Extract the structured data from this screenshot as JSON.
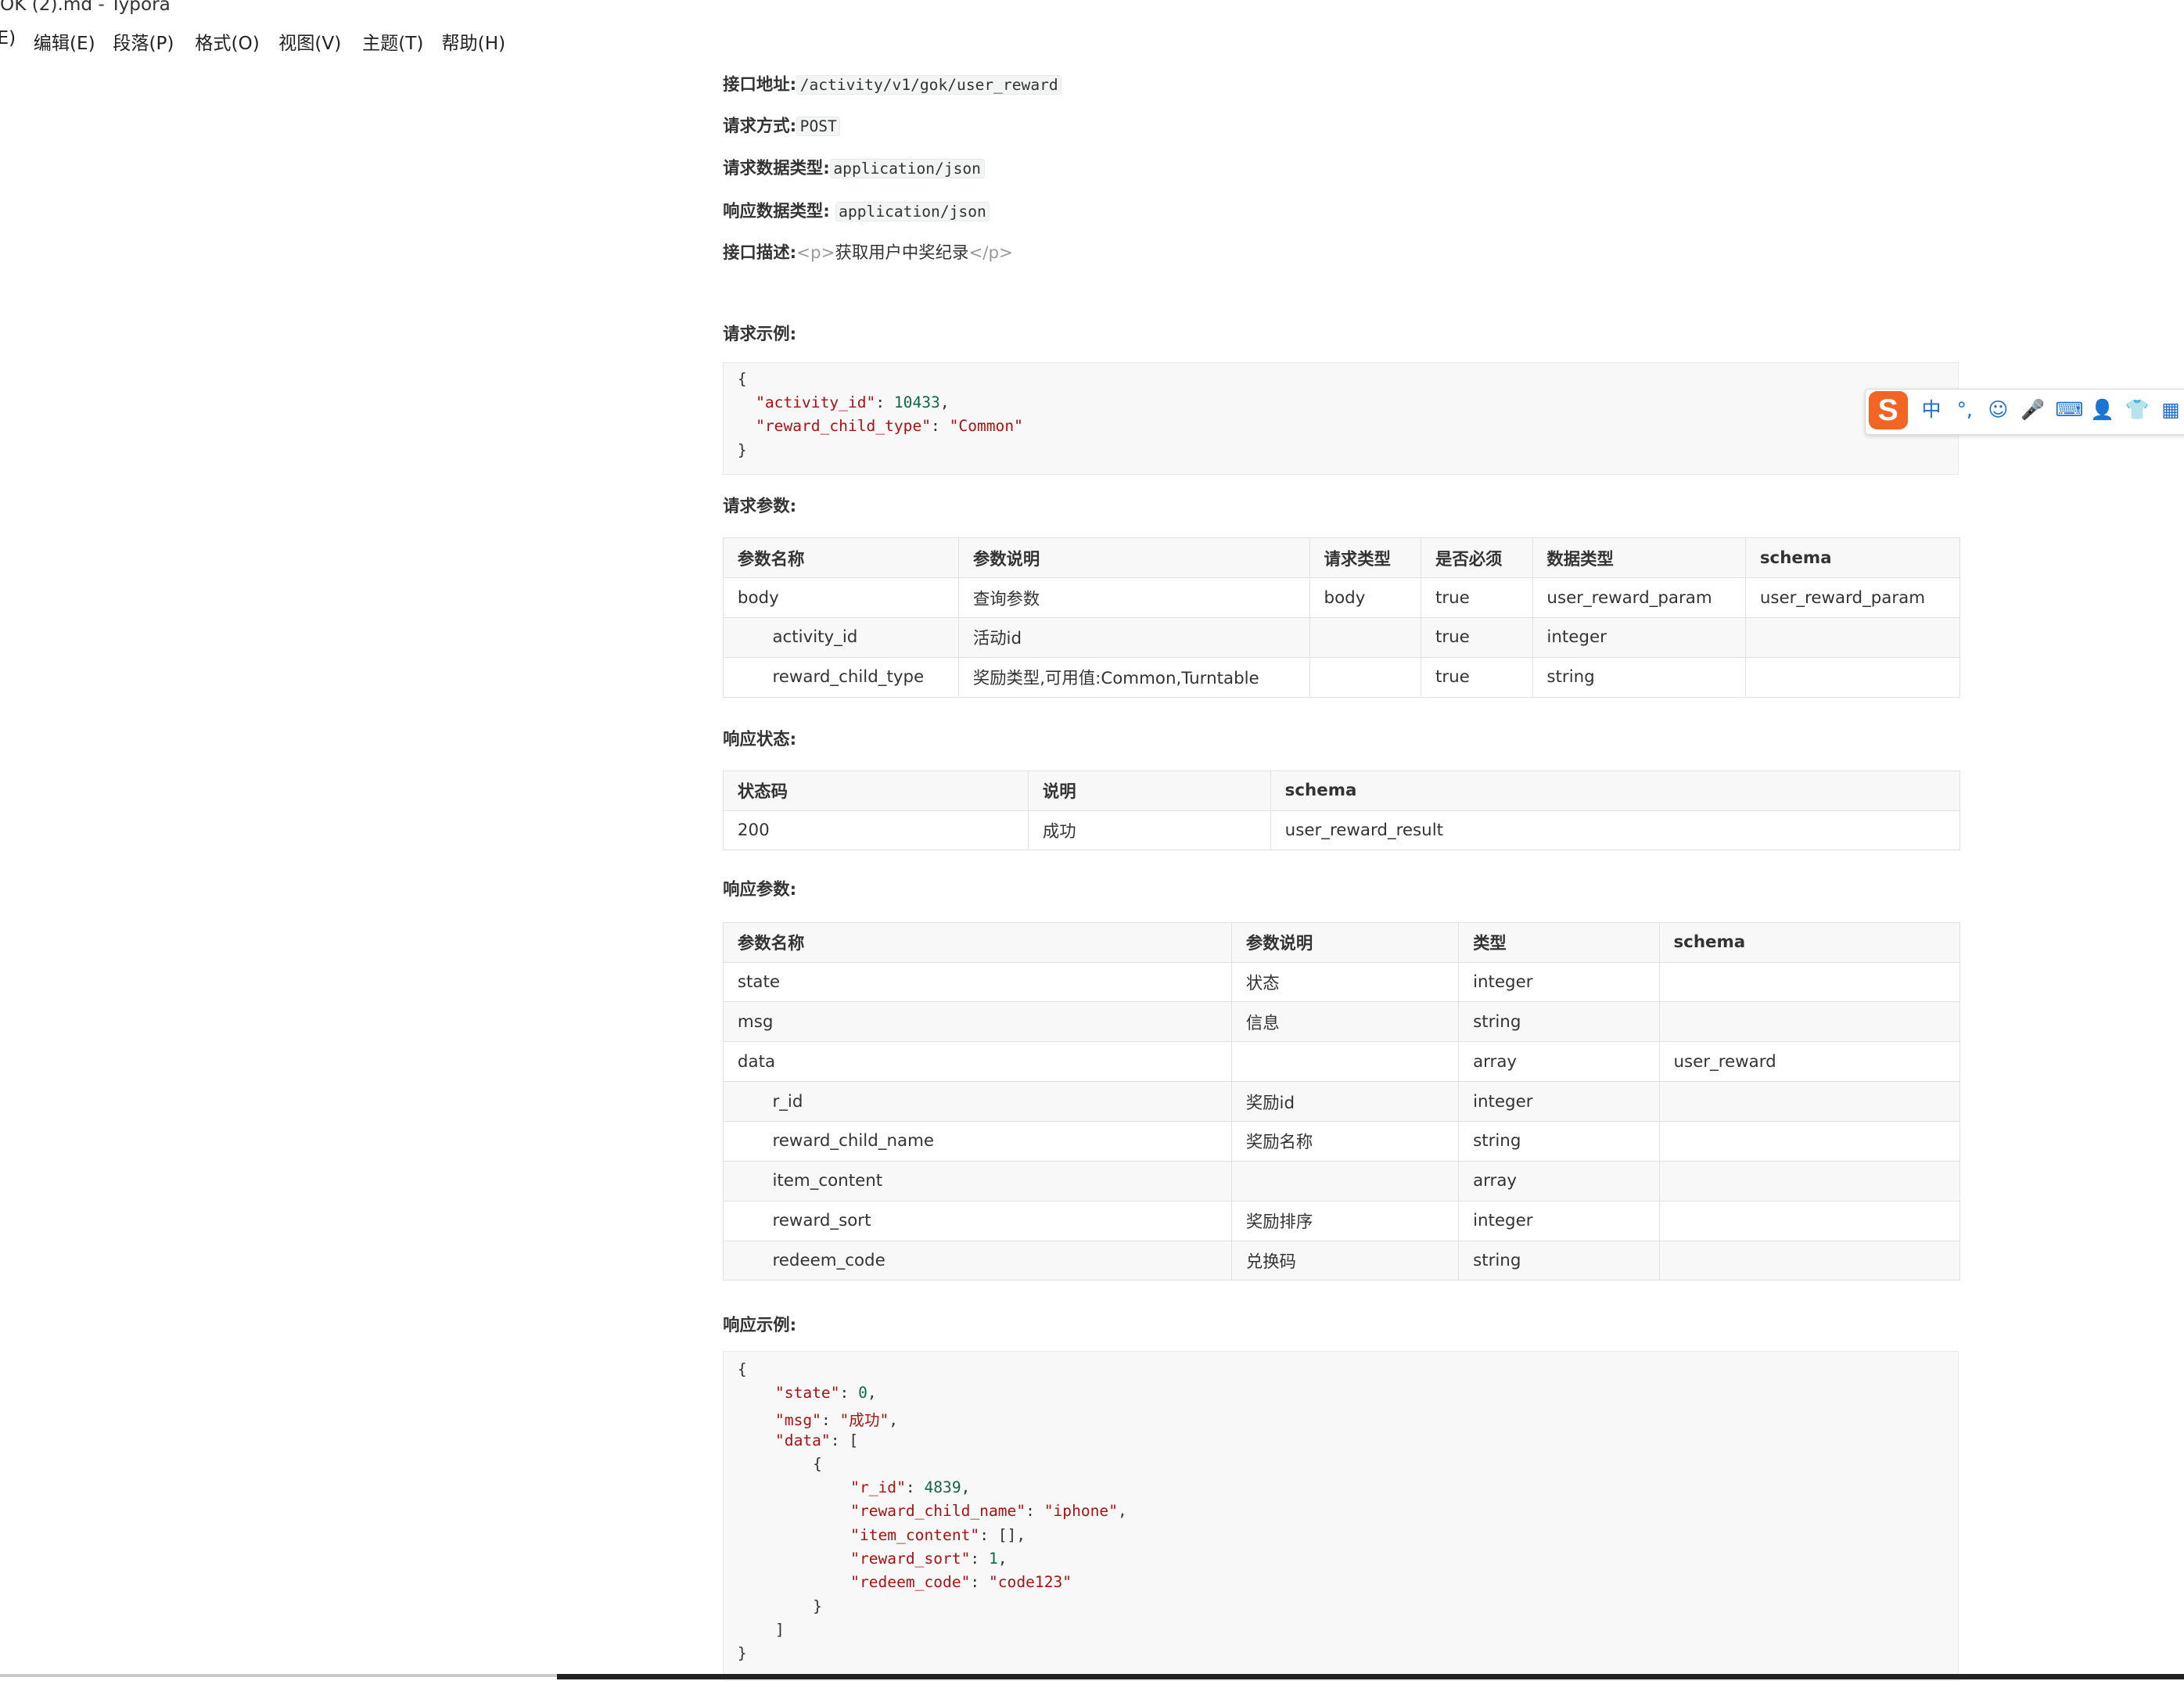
{
  "window": {
    "title": "OK (2).md - Typora"
  },
  "menu": [
    {
      "name": "menu-file",
      "label": "E)"
    },
    {
      "name": "menu-edit",
      "label": "编辑(E)"
    },
    {
      "name": "menu-paragraph",
      "label": "段落(P)"
    },
    {
      "name": "menu-format",
      "label": "格式(O)"
    },
    {
      "name": "menu-view",
      "label": "视图(V)"
    },
    {
      "name": "menu-theme",
      "label": "主题(T)"
    },
    {
      "name": "menu-help",
      "label": "帮助(H)"
    }
  ],
  "meta": {
    "url_label": "接口地址:",
    "url_value": "/activity/v1/gok/user_reward",
    "method_label": "请求方式:",
    "method_value": "POST",
    "req_type_label": "请求数据类型:",
    "req_type_value": "application/json",
    "resp_type_label": "响应数据类型:",
    "resp_type_value": "application/json",
    "desc_label": "接口描述:",
    "desc_open": "<p>",
    "desc_text": "获取用户中奖纪录",
    "desc_close": "</p>"
  },
  "sections": {
    "request_example": "请求示例:",
    "request_params": "请求参数:",
    "response_status": "响应状态:",
    "response_params": "响应参数:",
    "response_example": "响应示例:"
  },
  "request_example": {
    "lines": [
      {
        "indent": 0,
        "text": "{"
      },
      {
        "indent": 1,
        "key": "\"activity_id\"",
        "sep": ": ",
        "value": "10433",
        "vtype": "num",
        "tail": ","
      },
      {
        "indent": 1,
        "key": "\"reward_child_type\"",
        "sep": ": ",
        "value": "\"Common\"",
        "vtype": "str",
        "tail": ""
      },
      {
        "indent": 0,
        "text": "}"
      }
    ]
  },
  "request_params_table": {
    "headers": [
      "参数名称",
      "参数说明",
      "请求类型",
      "是否必须",
      "数据类型",
      "schema"
    ],
    "rows": [
      {
        "indent": false,
        "cells": [
          "body",
          "查询参数",
          "body",
          "true",
          "user_reward_param",
          "user_reward_param"
        ]
      },
      {
        "indent": true,
        "cells": [
          "activity_id",
          "活动id",
          "",
          "true",
          "integer",
          ""
        ]
      },
      {
        "indent": true,
        "cells": [
          "reward_child_type",
          "奖励类型,可用值:Common,Turntable",
          "",
          "true",
          "string",
          ""
        ]
      }
    ]
  },
  "response_status_table": {
    "headers": [
      "状态码",
      "说明",
      "schema"
    ],
    "rows": [
      {
        "indent": false,
        "cells": [
          "200",
          "成功",
          "user_reward_result"
        ]
      }
    ]
  },
  "response_params_table": {
    "headers": [
      "参数名称",
      "参数说明",
      "类型",
      "schema"
    ],
    "rows": [
      {
        "indent": false,
        "cells": [
          "state",
          "状态",
          "integer",
          ""
        ]
      },
      {
        "indent": false,
        "cells": [
          "msg",
          "信息",
          "string",
          ""
        ]
      },
      {
        "indent": false,
        "cells": [
          "data",
          "",
          "array",
          "user_reward"
        ]
      },
      {
        "indent": true,
        "cells": [
          "r_id",
          "奖励id",
          "integer",
          ""
        ]
      },
      {
        "indent": true,
        "cells": [
          "reward_child_name",
          "奖励名称",
          "string",
          ""
        ]
      },
      {
        "indent": true,
        "cells": [
          "item_content",
          "",
          "array",
          ""
        ]
      },
      {
        "indent": true,
        "cells": [
          "reward_sort",
          "奖励排序",
          "integer",
          ""
        ]
      },
      {
        "indent": true,
        "cells": [
          "redeem_code",
          "兑换码",
          "string",
          ""
        ]
      }
    ]
  },
  "response_example": {
    "lines": [
      {
        "indent": 0,
        "text": "{"
      },
      {
        "indent": 1,
        "key": "\"state\"",
        "sep": ": ",
        "value": "0",
        "vtype": "num",
        "tail": ","
      },
      {
        "indent": 1,
        "key": "\"msg\"",
        "sep": ": ",
        "value": "\"成功\"",
        "vtype": "str",
        "tail": ","
      },
      {
        "indent": 1,
        "key": "\"data\"",
        "sep": ": ",
        "value": "[",
        "vtype": "plain",
        "tail": ""
      },
      {
        "indent": 2,
        "text": "{"
      },
      {
        "indent": 3,
        "key": "\"r_id\"",
        "sep": ": ",
        "value": "4839",
        "vtype": "num",
        "tail": ","
      },
      {
        "indent": 3,
        "key": "\"reward_child_name\"",
        "sep": ": ",
        "value": "\"iphone\"",
        "vtype": "str",
        "tail": ","
      },
      {
        "indent": 3,
        "key": "\"item_content\"",
        "sep": ": ",
        "value": "[]",
        "vtype": "plain",
        "tail": ","
      },
      {
        "indent": 3,
        "key": "\"reward_sort\"",
        "sep": ": ",
        "value": "1",
        "vtype": "num",
        "tail": ","
      },
      {
        "indent": 3,
        "key": "\"redeem_code\"",
        "sep": ": ",
        "value": "\"code123\"",
        "vtype": "str",
        "tail": ""
      },
      {
        "indent": 2,
        "text": "}"
      },
      {
        "indent": 1,
        "text": "]"
      },
      {
        "indent": 0,
        "text": "}"
      }
    ]
  },
  "ime_toolbar": {
    "logo": "S",
    "icons": [
      {
        "name": "ime-chinese-mode-icon",
        "glyph": "中"
      },
      {
        "name": "ime-punctuation-icon",
        "glyph": "°,"
      },
      {
        "name": "ime-emoji-icon",
        "glyph": "☺"
      },
      {
        "name": "ime-voice-icon",
        "glyph": "🎤"
      },
      {
        "name": "ime-keyboard-icon",
        "glyph": "⌨"
      },
      {
        "name": "ime-user-icon",
        "glyph": "👤"
      },
      {
        "name": "ime-skin-icon",
        "glyph": "👕"
      },
      {
        "name": "ime-toolbox-icon",
        "glyph": "▦"
      }
    ]
  }
}
